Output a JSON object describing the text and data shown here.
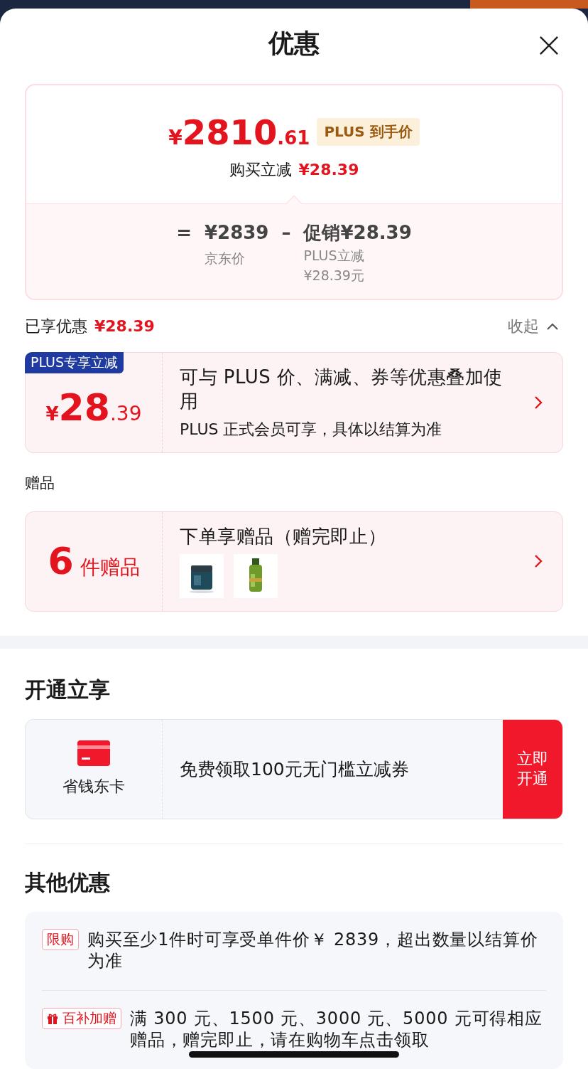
{
  "sheet": {
    "title": "优惠"
  },
  "price_summary": {
    "currency": "¥",
    "integer": "2810",
    "decimal": ".61",
    "badge": "PLUS 到手价",
    "reduction_label": "购买立减",
    "reduction_value": "¥28.39",
    "formula": {
      "equals": "=",
      "base": "¥2839",
      "base_label": "京东价",
      "minus": "–",
      "promo": "促销¥28.39",
      "promo_label": "PLUS立减",
      "promo_detail": "¥28.39元"
    }
  },
  "enjoyed": {
    "label": "已享优惠",
    "amount": "¥28.39",
    "toggle": "收起",
    "expanded": true
  },
  "discount_card": {
    "tag": "PLUS专享立减",
    "currency": "¥",
    "integer": "28",
    "decimal": ".39",
    "title": "可与 PLUS 价、满减、券等优惠叠加使用",
    "subtitle": "PLUS 正式会员可享，具体以结算为准"
  },
  "gifts": {
    "label": "赠品",
    "count": "6",
    "count_unit": "件赠品",
    "title": "下单享赠品（赠完即止）",
    "thumbnails": [
      {
        "kind": "jar"
      },
      {
        "kind": "bottle"
      }
    ]
  },
  "membership": {
    "title": "开通立享",
    "card_name": "省钱东卡",
    "offer": "免费领取100元无门槛立减券",
    "button": "立即开通"
  },
  "other": {
    "title": "其他优惠",
    "items": [
      {
        "kind": "plain",
        "tag": "限购",
        "text": "购买至少1件时可享受单件价￥ 2839，超出数量以结算价为准"
      },
      {
        "kind": "gift",
        "tag": "百补加赠",
        "text": "满 300 元、1500 元、3000 元、5000 元可得相应赠品，赠完即止，请在购物车点击领取"
      }
    ]
  }
}
